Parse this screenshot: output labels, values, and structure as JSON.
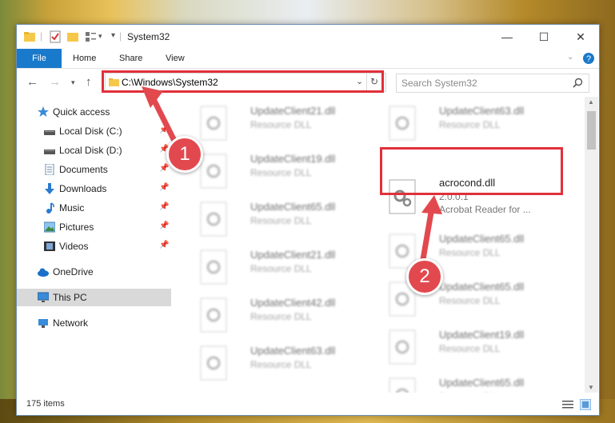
{
  "window": {
    "title": "System32"
  },
  "ribbon": {
    "file": "File",
    "home": "Home",
    "share": "Share",
    "view": "View"
  },
  "address": {
    "path": "C:\\Windows\\System32"
  },
  "search": {
    "placeholder": "Search System32"
  },
  "nav": {
    "quick_access": "Quick access",
    "items": [
      {
        "label": "Local Disk (C:)"
      },
      {
        "label": "Local Disk (D:)"
      },
      {
        "label": "Documents"
      },
      {
        "label": "Downloads"
      },
      {
        "label": "Music"
      },
      {
        "label": "Pictures"
      },
      {
        "label": "Videos"
      }
    ],
    "onedrive": "OneDrive",
    "thispc": "This PC",
    "network": "Network"
  },
  "files": {
    "left": [
      {
        "name": "UpdateClient21.dll",
        "type": "Resource DLL"
      },
      {
        "name": "UpdateClient19.dll",
        "type": "Resource DLL"
      },
      {
        "name": "UpdateClient65.dll",
        "type": "Resource DLL"
      },
      {
        "name": "UpdateClient21.dll",
        "type": "Resource DLL"
      },
      {
        "name": "UpdateClient42.dll",
        "type": "Resource DLL"
      },
      {
        "name": "UpdateClient63.dll",
        "type": "Resource DLL"
      }
    ],
    "right": [
      {
        "name": "UpdateClient63.dll",
        "type": "Resource DLL"
      },
      {
        "name": "UpdateClient65.dll",
        "type": "Resource DLL"
      },
      {
        "name": "UpdateClient65.dll",
        "type": "Resource DLL"
      },
      {
        "name": "UpdateClient19.dll",
        "type": "Resource DLL"
      },
      {
        "name": "UpdateClient65.dll",
        "type": "Resource DLL"
      }
    ],
    "highlight": {
      "name": "acrocond.dll",
      "version": "2.0.0.1",
      "description": "Acrobat Reader for ..."
    }
  },
  "status": {
    "count": "175 items"
  },
  "annotations": {
    "step1": "1",
    "step2": "2",
    "color": "#e2494f"
  }
}
